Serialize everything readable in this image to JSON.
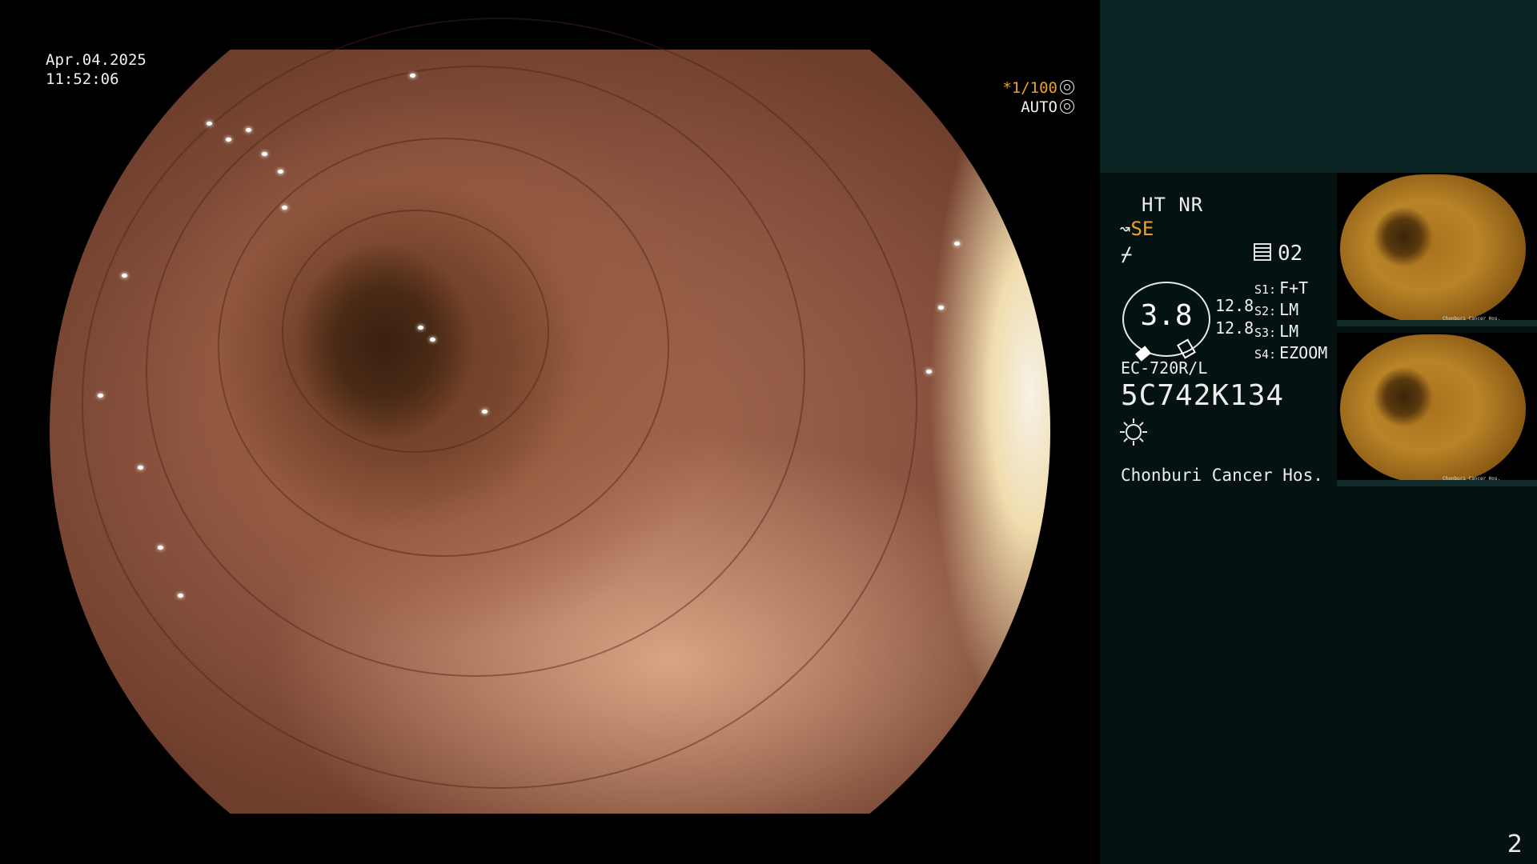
{
  "overlay": {
    "date": "Apr.04.2025",
    "time": "11:52:06",
    "shutter_prefix": "*",
    "shutter_value": "1/100",
    "iris_mode": "AUTO"
  },
  "panel": {
    "mode_line": "HT NR",
    "enhance_label": "SE",
    "page_number": "02",
    "dial_value": "3.8",
    "exposure_1": "12.8",
    "exposure_2": "12.8",
    "slots": [
      {
        "key": "S1:",
        "value": "F+T"
      },
      {
        "key": "S2:",
        "value": "LM"
      },
      {
        "key": "S3:",
        "value": "LM"
      },
      {
        "key": "S4:",
        "value": "EZOOM"
      }
    ],
    "scope_model": "EC-720R/L",
    "scope_serial": "5C742K134",
    "hospital": "Chonburi Cancer Hos.",
    "screen_index": "2"
  },
  "thumbnails": {
    "caption": "Chonburi Cancer Hos."
  },
  "colors": {
    "accent_orange": "#f0a020",
    "panel_bg": "#041312",
    "panel_top_bg": "#0a2523"
  }
}
